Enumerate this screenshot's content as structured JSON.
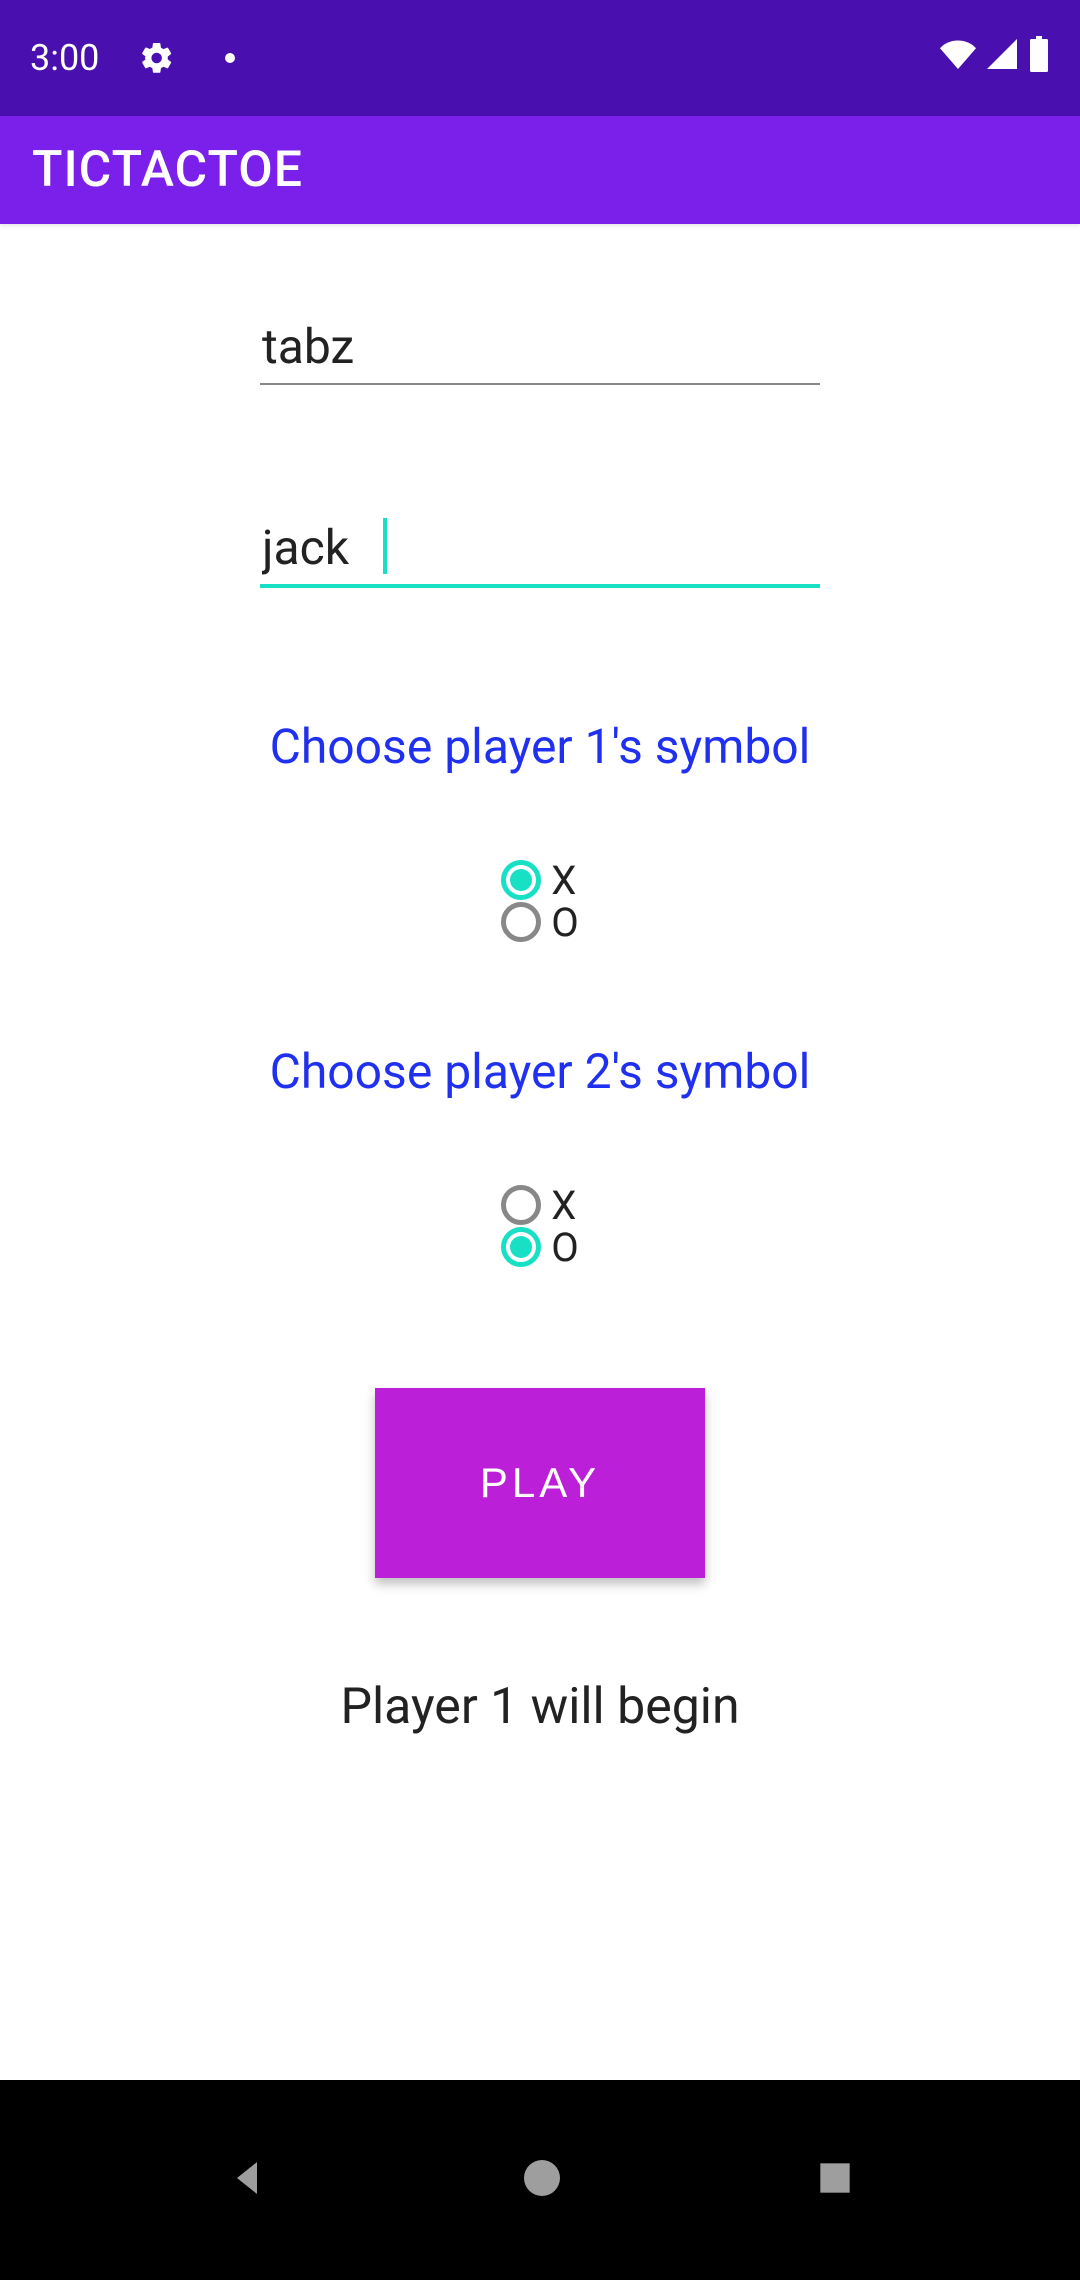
{
  "status_bar": {
    "time": "3:00"
  },
  "app_bar": {
    "title": "TICTACTOE"
  },
  "form": {
    "player1_name": "tabz",
    "player2_name": "jack",
    "section1_label": "Choose player 1's symbol",
    "section2_label": "Choose player 2's symbol",
    "p1_options": {
      "x": "X",
      "o": "O",
      "selected": "x"
    },
    "p2_options": {
      "x": "X",
      "o": "O",
      "selected": "o"
    },
    "play_label": "PLAY",
    "status_text": "Player 1 will begin"
  }
}
